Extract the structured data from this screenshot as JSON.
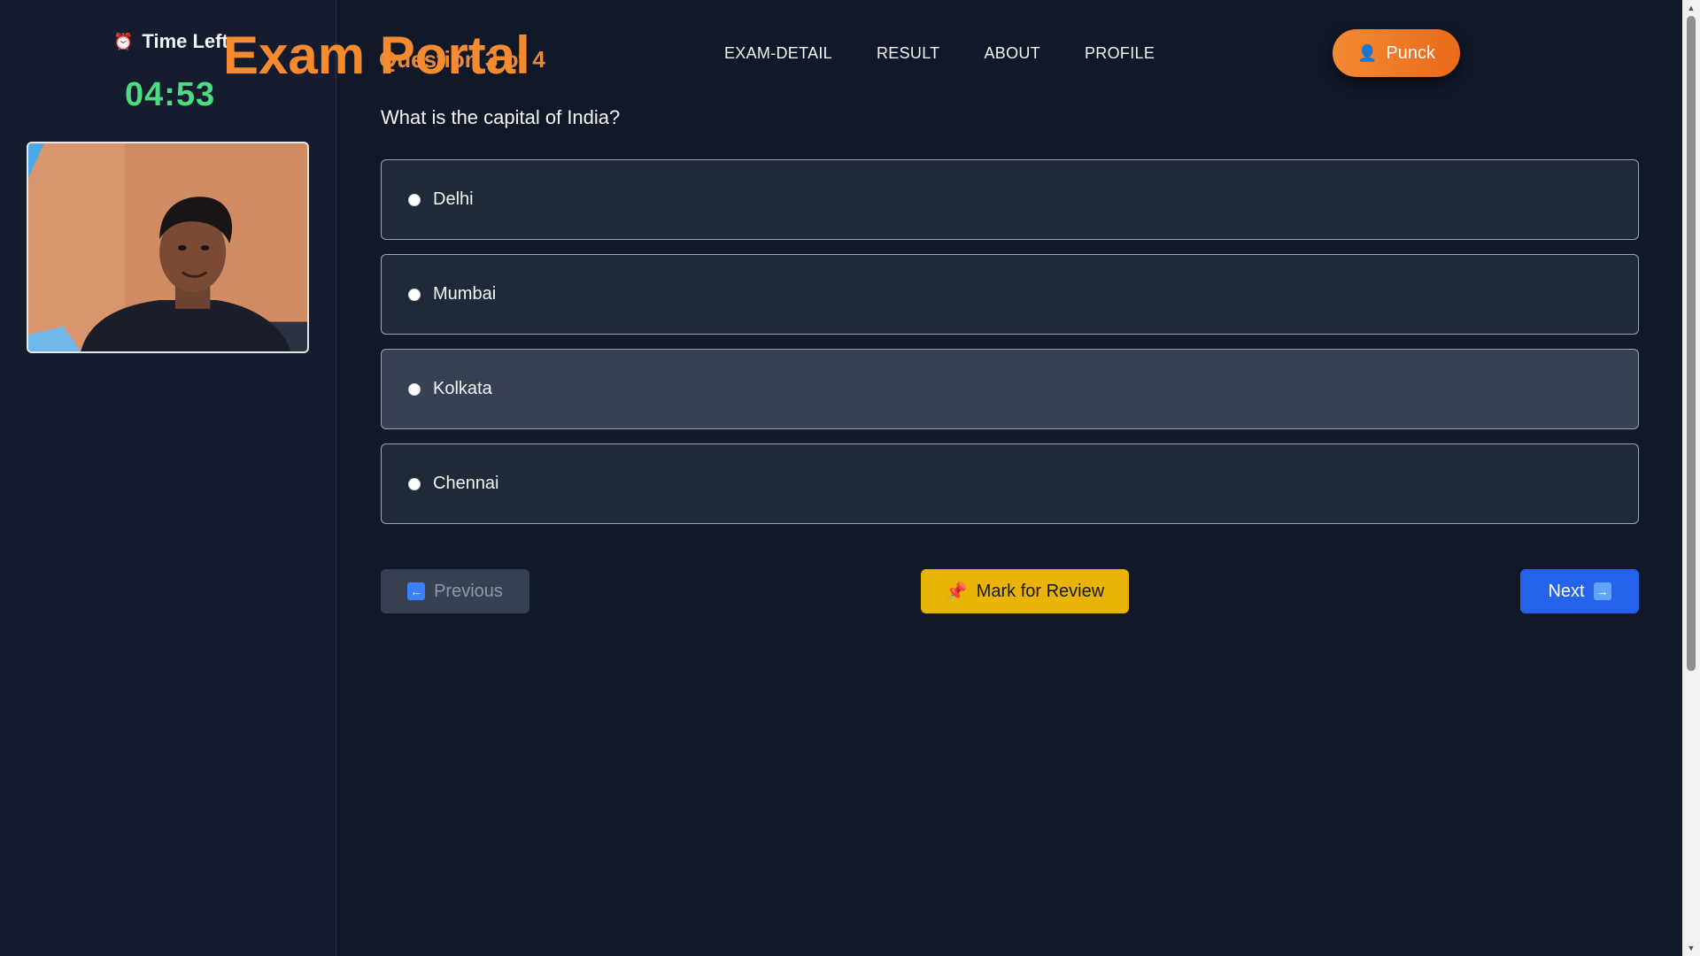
{
  "app": {
    "brand": "Exam Portal",
    "question_counter": "Question 3 of 4"
  },
  "nav": {
    "items": [
      "EXAM-DETAIL",
      "RESULT",
      "ABOUT",
      "PROFILE"
    ]
  },
  "user": {
    "name": "Punck",
    "icon": "user-icon"
  },
  "timer": {
    "label": "Time Left",
    "value": "04:53",
    "icon": "alarm-clock-icon",
    "color": "#4ade80"
  },
  "webcam": {
    "icon": "webcam-feed"
  },
  "question": {
    "text": "What is the capital of India?",
    "options": [
      "Delhi",
      "Mumbai",
      "Kolkata",
      "Chennai"
    ],
    "selected": null
  },
  "actions": {
    "previous_label": "Previous",
    "review_label": "Mark for Review",
    "next_label": "Next",
    "previous_icon": "arrow-left-icon",
    "review_icon": "pin-icon",
    "next_icon": "arrow-right-icon"
  },
  "colors": {
    "brand": "#f58a2f",
    "profile_button": "#ef7a26",
    "review_button": "#eab308",
    "next_button": "#2563eb",
    "background": "#111827"
  }
}
